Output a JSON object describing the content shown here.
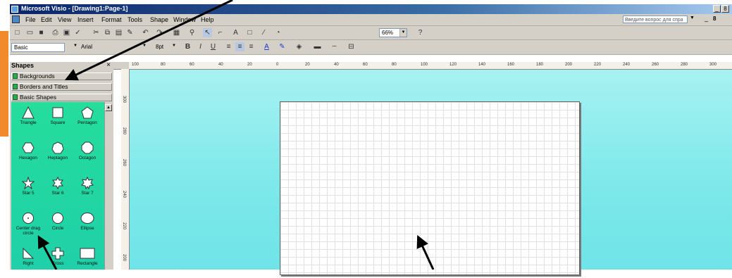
{
  "window": {
    "title": "Microsoft Visio - [Drawing1:Page-1]",
    "minimize": "_",
    "restore": "8"
  },
  "menu": {
    "items": [
      "File",
      "Edit",
      "View",
      "Insert",
      "Format",
      "Tools",
      "Shape",
      "Window",
      "Help"
    ],
    "help_placeholder": "Введите вопрос для спра",
    "doc_minimize": "_",
    "doc_restore": "8"
  },
  "toolbar": {
    "zoom": "66%",
    "style": "Basic",
    "font": "Arial",
    "size": "8pt",
    "bold": "B",
    "italic": "I",
    "underline": "U",
    "text_a": "A"
  },
  "shapes_panel": {
    "title": "Shapes",
    "close": "×",
    "stencils": [
      "Backgrounds",
      "Borders and Titles",
      "Basic Shapes"
    ],
    "shapes": [
      {
        "label": "Triangle",
        "icon": "triangle-icon"
      },
      {
        "label": "Square",
        "icon": "square-icon"
      },
      {
        "label": "Pentagon",
        "icon": "pentagon-icon"
      },
      {
        "label": "Hexagon",
        "icon": "hexagon-icon"
      },
      {
        "label": "Heptagon",
        "icon": "heptagon-icon"
      },
      {
        "label": "Octagon",
        "icon": "octagon-icon"
      },
      {
        "label": "Star 5",
        "icon": "star5-icon"
      },
      {
        "label": "Star 6",
        "icon": "star6-icon"
      },
      {
        "label": "Star 7",
        "icon": "star7-icon"
      },
      {
        "label": "Center drag circle",
        "icon": "center-drag-circle-icon"
      },
      {
        "label": "Circle",
        "icon": "circle-icon"
      },
      {
        "label": "Ellipse",
        "icon": "ellipse-icon"
      },
      {
        "label": "Right",
        "icon": "right-triangle-icon"
      },
      {
        "label": "Cross",
        "icon": "cross-icon"
      },
      {
        "label": "Rectangle",
        "icon": "rectangle-icon"
      }
    ]
  },
  "ruler": {
    "top_ticks": [
      "100",
      "80",
      "60",
      "40",
      "20",
      "0",
      "20",
      "40",
      "60",
      "80",
      "100",
      "120",
      "140",
      "160",
      "180",
      "200",
      "220",
      "240",
      "260",
      "280",
      "300"
    ],
    "left_ticks": [
      "300",
      "280",
      "260",
      "240",
      "220",
      "200"
    ]
  },
  "colors": {
    "canvas": "#7ce8ea",
    "stencil": "#22d6a0",
    "titlebar": "#0a246a",
    "accent_tab": "#f08a2a"
  }
}
